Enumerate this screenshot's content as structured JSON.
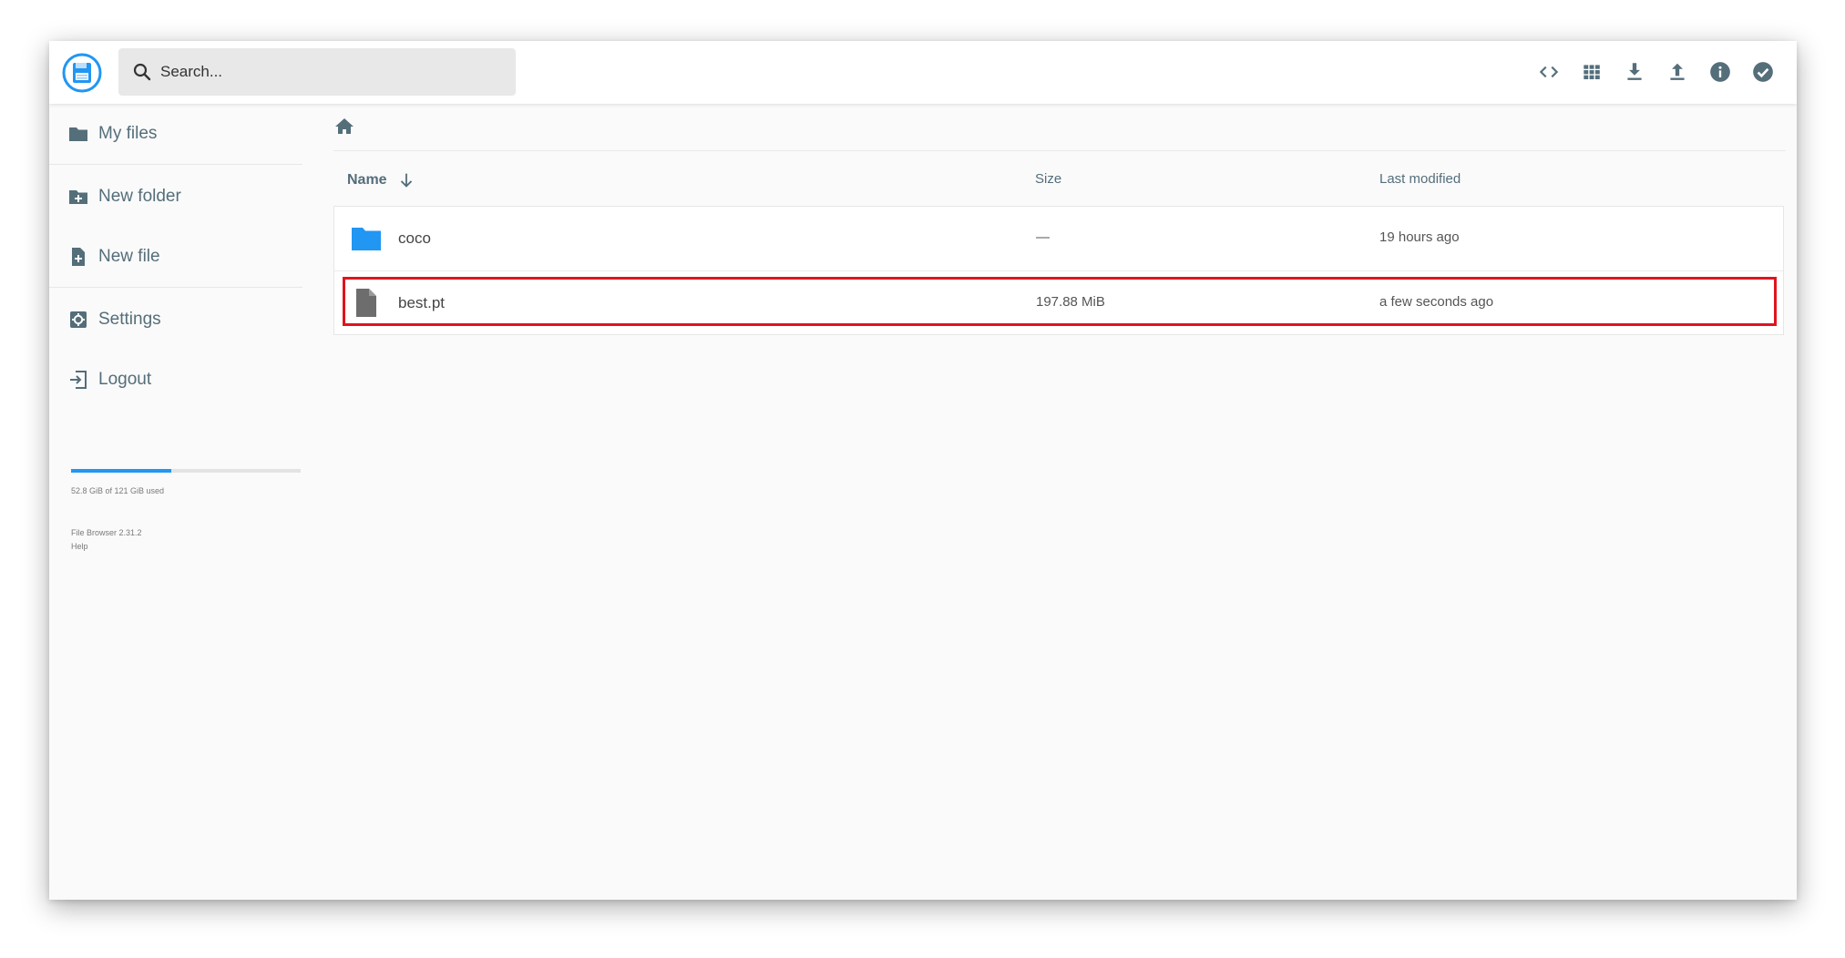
{
  "search": {
    "placeholder": "Search..."
  },
  "toolbar": {
    "tools": [
      "code-icon",
      "grid-view-icon",
      "download-icon",
      "upload-icon",
      "info-icon",
      "check-circle-icon"
    ]
  },
  "sidebar": {
    "items": [
      {
        "label": "My files",
        "icon": "folder-icon"
      },
      {
        "label": "New folder",
        "icon": "folder-plus-icon"
      },
      {
        "label": "New file",
        "icon": "file-plus-icon"
      },
      {
        "label": "Settings",
        "icon": "settings-icon"
      },
      {
        "label": "Logout",
        "icon": "logout-icon"
      }
    ],
    "quota": {
      "text": "52.8 GiB of 121 GiB used",
      "used_fraction": 0.436
    },
    "version": "File Browser 2.31.2",
    "help": "Help"
  },
  "listing": {
    "columns": {
      "name": "Name",
      "size": "Size",
      "modified": "Last modified"
    },
    "rows": [
      {
        "name": "coco",
        "size": "—",
        "modified": "19 hours ago",
        "type": "folder"
      },
      {
        "name": "best.pt",
        "size": "197.88 MiB",
        "modified": "a few seconds ago",
        "type": "file",
        "highlighted": true
      }
    ]
  },
  "colors": {
    "accent": "#2196f3",
    "text": "#546e7a",
    "highlight": "#e0141e"
  }
}
